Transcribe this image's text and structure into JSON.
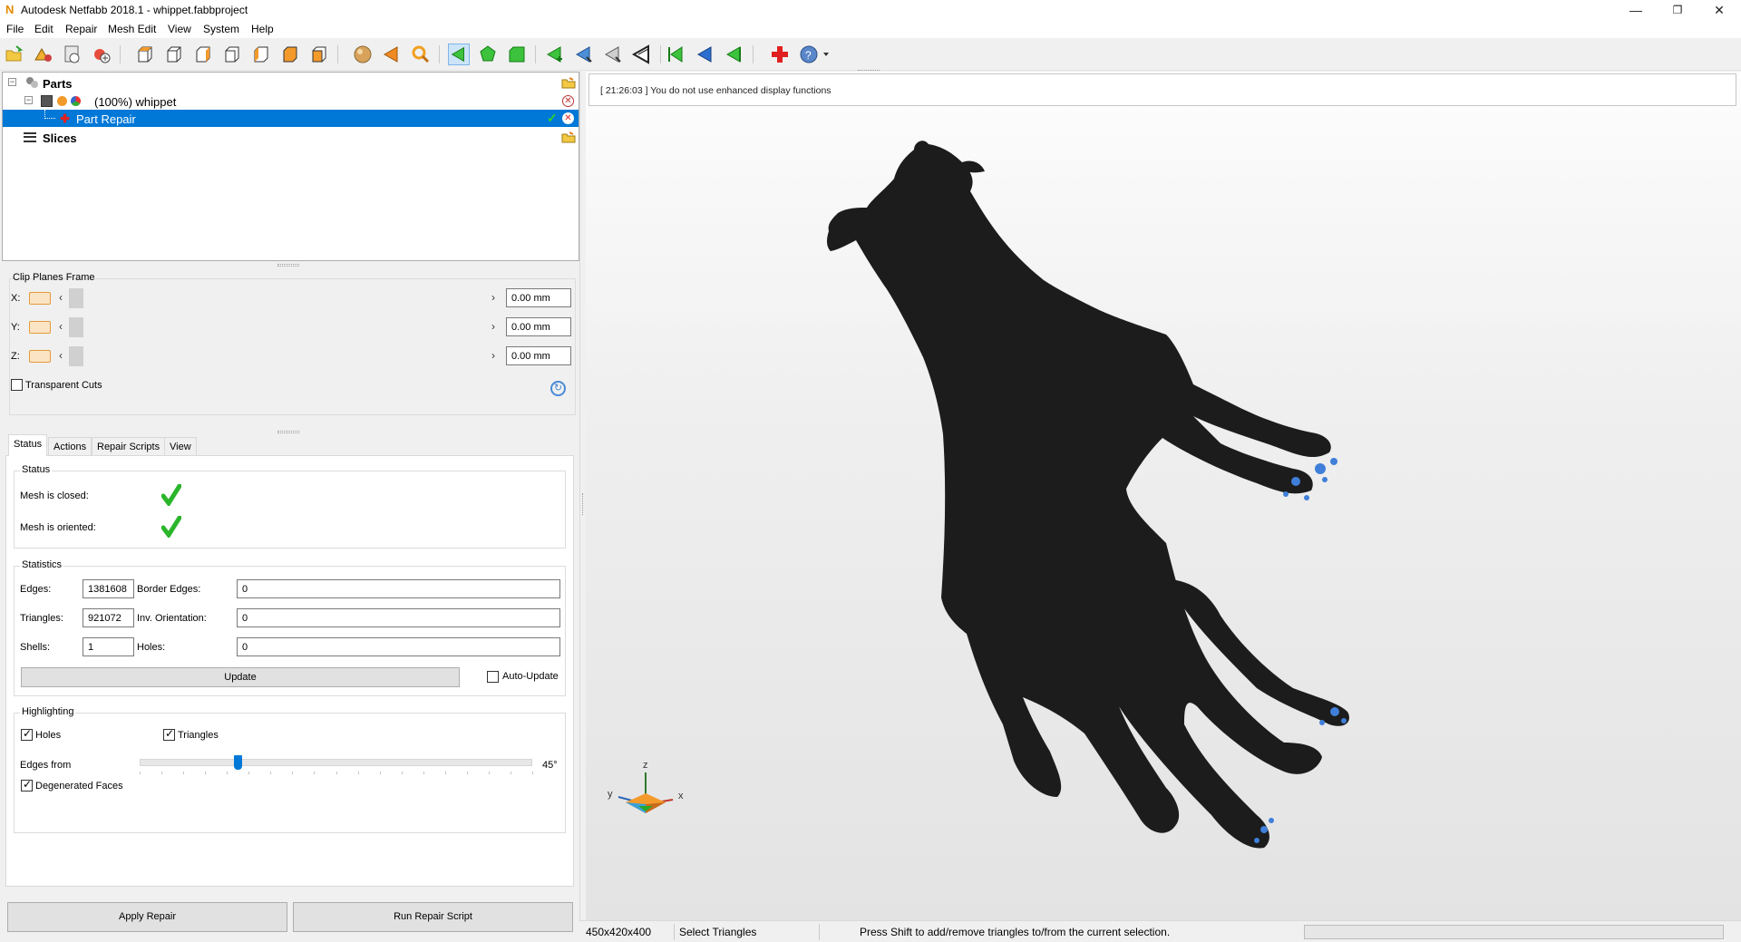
{
  "window": {
    "title": "Autodesk Netfabb 2018.1 - whippet.fabbproject",
    "minimize": "—",
    "restore": "❐",
    "close": "✕"
  },
  "menu": [
    "File",
    "Edit",
    "Repair",
    "Mesh Edit",
    "View",
    "System",
    "Help"
  ],
  "tree": {
    "parts_label": "Parts",
    "part_label": "(100%) whippet",
    "repair_label": "Part Repair",
    "slices_label": "Slices"
  },
  "clip_planes": {
    "title": "Clip Planes Frame",
    "rows": [
      {
        "axis": "X:",
        "value": "0.00 mm"
      },
      {
        "axis": "Y:",
        "value": "0.00 mm"
      },
      {
        "axis": "Z:",
        "value": "0.00 mm"
      }
    ],
    "transparent_cuts": "Transparent Cuts",
    "transparent_cuts_checked": false
  },
  "tabs": [
    "Status",
    "Actions",
    "Repair Scripts",
    "View"
  ],
  "status": {
    "group_title": "Status",
    "mesh_closed": "Mesh is closed:",
    "mesh_oriented": "Mesh is oriented:"
  },
  "statistics": {
    "group_title": "Statistics",
    "edges_label": "Edges:",
    "edges": "1381608",
    "border_edges_label": "Border Edges:",
    "border_edges": "0",
    "triangles_label": "Triangles:",
    "triangles": "921072",
    "inv_orientation_label": "Inv. Orientation:",
    "inv_orientation": "0",
    "shells_label": "Shells:",
    "shells": "1",
    "holes_label": "Holes:",
    "holes": "0",
    "update_button": "Update",
    "auto_update": "Auto-Update",
    "auto_update_checked": false
  },
  "highlighting": {
    "group_title": "Highlighting",
    "holes": "Holes",
    "holes_checked": true,
    "triangles": "Triangles",
    "triangles_checked": true,
    "edges_from": "Edges from",
    "angle_value": 45,
    "angle_max": 180,
    "angle_text": "45°",
    "degenerated": "Degenerated Faces",
    "degenerated_checked": true
  },
  "buttons": {
    "apply_repair": "Apply Repair",
    "run_repair_script": "Run Repair Script"
  },
  "log": "[ 21:26:03 ] You do not use enhanced display functions",
  "axes": {
    "z": "z",
    "y": "y",
    "x": "x"
  },
  "statusbar": {
    "size": "450x420x400",
    "mode": "Select Triangles",
    "hint": "Press Shift to add/remove triangles to/from the current selection."
  },
  "colors": {
    "selection": "#0078d7",
    "model": "#1c1c1c",
    "paw_highlight": "#3f7fd9",
    "check_green": "#2bb52b",
    "repair_red": "#e02020"
  }
}
